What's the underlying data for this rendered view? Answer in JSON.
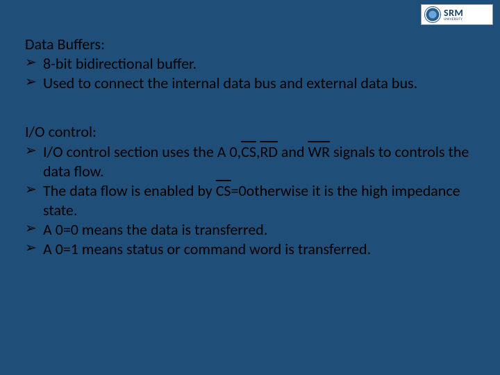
{
  "logo": {
    "main": "SRM",
    "sub": "UNIVERSITY"
  },
  "section1": {
    "heading": "Data Buffers:",
    "items": [
      "8-bit bidirectional buffer.",
      "Used to connect the internal data bus and external data bus."
    ]
  },
  "section2": {
    "heading": "I/O control:",
    "item1_parts": {
      "p1": "I/O control section uses the A 0,",
      "cs": "CS",
      "comma1": ",",
      "rd": "RD",
      "p2": " and ",
      "wr": "WR",
      "p3": " signals to controls the data flow."
    },
    "item2_parts": {
      "p1": "The data flow is enabled by ",
      "cs": "CS",
      "p2": "=0otherwise it is the high impedance state."
    },
    "item3": "A 0=0 means the data is transferred.",
    "item4": "A 0=1 means status or command word is transferred."
  }
}
